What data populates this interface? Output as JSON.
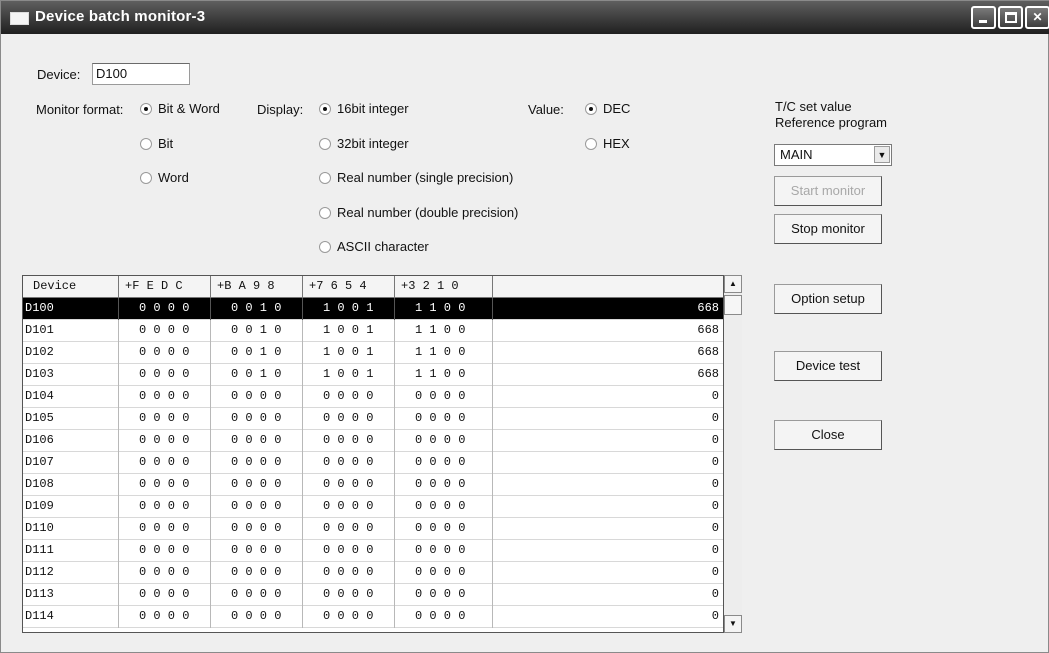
{
  "window": {
    "title": "Device batch monitor-3"
  },
  "device": {
    "label": "Device:",
    "value": "D100"
  },
  "monitor_format": {
    "label": "Monitor format:",
    "options": [
      {
        "label": "Bit & Word",
        "selected": true
      },
      {
        "label": "Bit",
        "selected": false
      },
      {
        "label": "Word",
        "selected": false
      }
    ]
  },
  "display": {
    "label": "Display:",
    "options": [
      {
        "label": "16bit integer",
        "selected": true
      },
      {
        "label": "32bit integer",
        "selected": false
      },
      {
        "label": "Real number (single precision)",
        "selected": false
      },
      {
        "label": "Real number (double precision)",
        "selected": false
      },
      {
        "label": "ASCII character",
        "selected": false
      }
    ]
  },
  "value": {
    "label": "Value:",
    "options": [
      {
        "label": "DEC",
        "selected": true
      },
      {
        "label": "HEX",
        "selected": false
      }
    ]
  },
  "tc_set": {
    "label_line1": "T/C set value",
    "label_line2": "Reference program",
    "selected": "MAIN"
  },
  "buttons": {
    "start_monitor": "Start monitor",
    "stop_monitor": "Stop monitor",
    "option_setup": "Option setup",
    "device_test": "Device test",
    "close": "Close"
  },
  "table": {
    "columns": [
      "Device",
      "+F E D C",
      "+B A 9 8",
      "+7 6 5 4",
      "+3 2 1 0",
      ""
    ],
    "selected_row": 0,
    "rows": [
      {
        "device": "D100",
        "b1": "0 0 0 0",
        "b2": "0 0 1 0",
        "b3": "1 0 0 1",
        "b4": "1 1 0 0",
        "value": "668"
      },
      {
        "device": "D101",
        "b1": "0 0 0 0",
        "b2": "0 0 1 0",
        "b3": "1 0 0 1",
        "b4": "1 1 0 0",
        "value": "668"
      },
      {
        "device": "D102",
        "b1": "0 0 0 0",
        "b2": "0 0 1 0",
        "b3": "1 0 0 1",
        "b4": "1 1 0 0",
        "value": "668"
      },
      {
        "device": "D103",
        "b1": "0 0 0 0",
        "b2": "0 0 1 0",
        "b3": "1 0 0 1",
        "b4": "1 1 0 0",
        "value": "668"
      },
      {
        "device": "D104",
        "b1": "0 0 0 0",
        "b2": "0 0 0 0",
        "b3": "0 0 0 0",
        "b4": "0 0 0 0",
        "value": "0"
      },
      {
        "device": "D105",
        "b1": "0 0 0 0",
        "b2": "0 0 0 0",
        "b3": "0 0 0 0",
        "b4": "0 0 0 0",
        "value": "0"
      },
      {
        "device": "D106",
        "b1": "0 0 0 0",
        "b2": "0 0 0 0",
        "b3": "0 0 0 0",
        "b4": "0 0 0 0",
        "value": "0"
      },
      {
        "device": "D107",
        "b1": "0 0 0 0",
        "b2": "0 0 0 0",
        "b3": "0 0 0 0",
        "b4": "0 0 0 0",
        "value": "0"
      },
      {
        "device": "D108",
        "b1": "0 0 0 0",
        "b2": "0 0 0 0",
        "b3": "0 0 0 0",
        "b4": "0 0 0 0",
        "value": "0"
      },
      {
        "device": "D109",
        "b1": "0 0 0 0",
        "b2": "0 0 0 0",
        "b3": "0 0 0 0",
        "b4": "0 0 0 0",
        "value": "0"
      },
      {
        "device": "D110",
        "b1": "0 0 0 0",
        "b2": "0 0 0 0",
        "b3": "0 0 0 0",
        "b4": "0 0 0 0",
        "value": "0"
      },
      {
        "device": "D111",
        "b1": "0 0 0 0",
        "b2": "0 0 0 0",
        "b3": "0 0 0 0",
        "b4": "0 0 0 0",
        "value": "0"
      },
      {
        "device": "D112",
        "b1": "0 0 0 0",
        "b2": "0 0 0 0",
        "b3": "0 0 0 0",
        "b4": "0 0 0 0",
        "value": "0"
      },
      {
        "device": "D113",
        "b1": "0 0 0 0",
        "b2": "0 0 0 0",
        "b3": "0 0 0 0",
        "b4": "0 0 0 0",
        "value": "0"
      },
      {
        "device": "D114",
        "b1": "0 0 0 0",
        "b2": "0 0 0 0",
        "b3": "0 0 0 0",
        "b4": "0 0 0 0",
        "value": "0"
      }
    ]
  }
}
